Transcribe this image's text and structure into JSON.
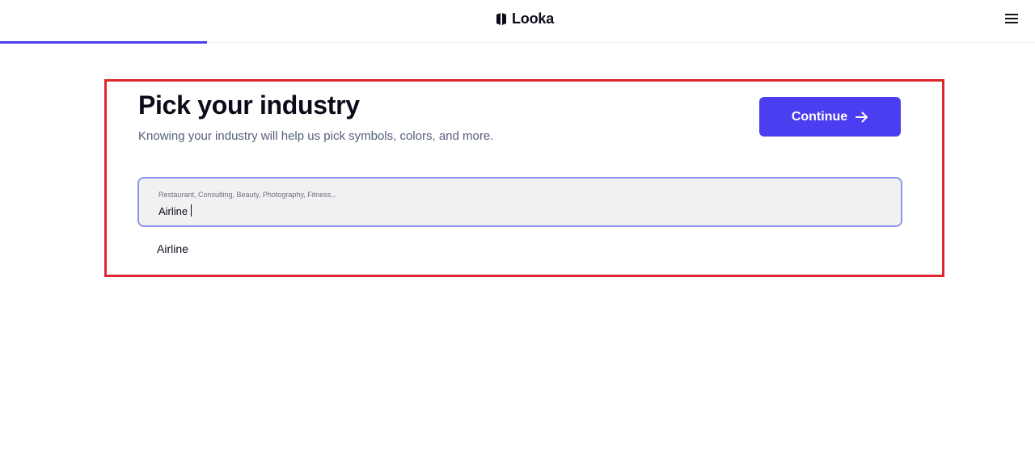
{
  "header": {
    "brand": "Looka",
    "logo_icon": "looka-logo-icon",
    "menu_icon": "hamburger-menu-icon",
    "progress_fraction": 0.2
  },
  "main": {
    "title": "Pick your industry",
    "subtitle": "Knowing your industry will help us pick symbols, colors, and more.",
    "continue_label": "Continue",
    "continue_icon": "arrow-right-icon",
    "search": {
      "placeholder": "Restaurant, Consulting, Beauty, Photography, Fitness...",
      "value": "Airline"
    },
    "suggestions": [
      "Airline"
    ]
  },
  "colors": {
    "accent": "#4b3df0",
    "field_border": "#8a95f2",
    "highlight_border": "#e0252f",
    "subtitle": "#55607a"
  }
}
